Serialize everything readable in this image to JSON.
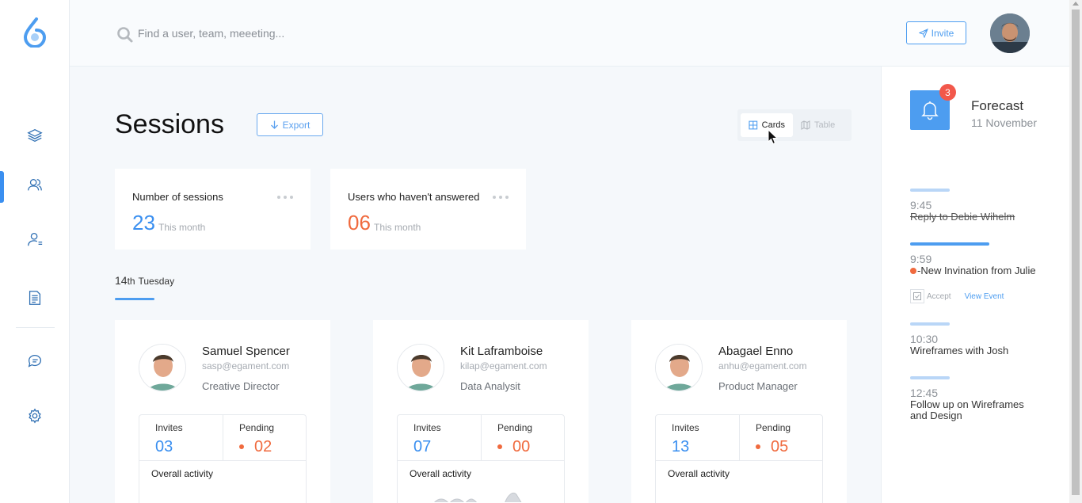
{
  "header": {
    "search_placeholder": "Find a user, team, meeeting...",
    "invite_label": "Invite"
  },
  "main": {
    "title": "Sessions",
    "export_label": "Export",
    "view_toggle": {
      "cards_label": "Cards",
      "table_label": "Table",
      "selected": "Cards"
    },
    "stats": [
      {
        "label": "Number of sessions",
        "value": "23",
        "sub": "This month",
        "color": "#3a8ff0"
      },
      {
        "label": "Users who haven't answered",
        "value": "06",
        "sub": "This month",
        "color": "#f06a3e"
      }
    ],
    "day": {
      "num": "14",
      "suffix": "th",
      "weekday": "Tuesday"
    },
    "users": [
      {
        "name": "Samuel Spencer",
        "email": "sasp@egament.com",
        "role": "Creative Director",
        "invites_label": "Invites",
        "invites": "03",
        "pending_label": "Pending",
        "pending": "02",
        "activity_label": "Overall activity"
      },
      {
        "name": "Kit Laframboise",
        "email": "kilap@egament.com",
        "role": "Data Analysit",
        "invites_label": "Invites",
        "invites": "07",
        "pending_label": "Pending",
        "pending": "00",
        "activity_label": "Overall activity"
      },
      {
        "name": "Abagael Enno",
        "email": "anhu@egament.com",
        "role": "Product Manager",
        "invites_label": "Invites",
        "invites": "13",
        "pending_label": "Pending",
        "pending": "05",
        "activity_label": "Overall activity"
      }
    ]
  },
  "forecast": {
    "badge": "3",
    "title": "Forecast",
    "date": "11 November",
    "events": [
      {
        "time": "9:45",
        "title": "Reply to Debie Wihelm",
        "done": true
      },
      {
        "time": "9:59",
        "title": "-New Invination from Julie",
        "accept_label": "Accept",
        "view_label": "View Event"
      },
      {
        "time": "10:30",
        "title": "Wireframes with Josh"
      },
      {
        "time": "12:45",
        "title": "Follow up on Wireframes and Design"
      }
    ]
  },
  "colors": {
    "accent": "#4d9df0",
    "danger": "#f06a3e",
    "badge": "#f2584b"
  },
  "icons": [
    "logo-icon",
    "layers-icon",
    "users-icon",
    "user-icon",
    "document-icon",
    "chat-icon",
    "gear-icon",
    "search-icon",
    "send-icon",
    "download-icon",
    "grid-icon",
    "map-icon",
    "bell-icon",
    "check-icon"
  ]
}
